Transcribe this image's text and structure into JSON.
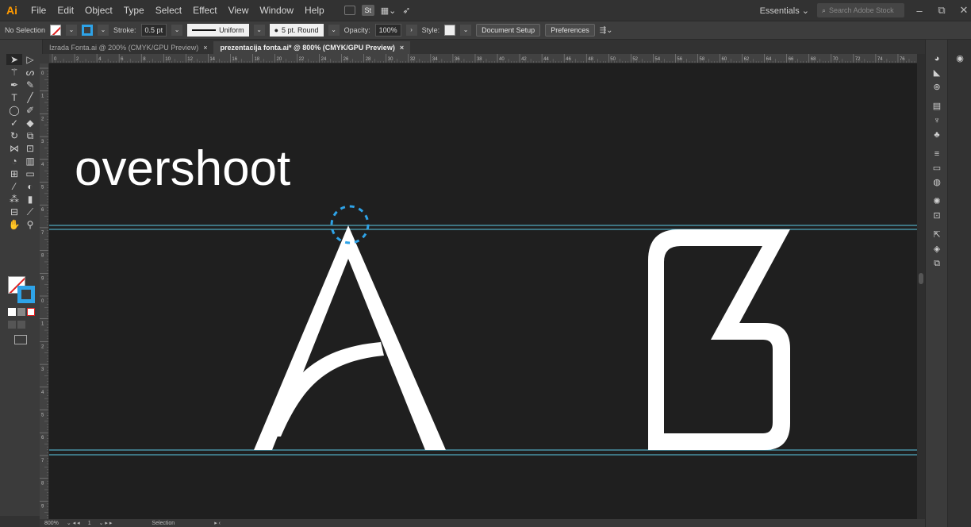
{
  "app": {
    "logo": "Ai"
  },
  "menu": [
    "File",
    "Edit",
    "Object",
    "Type",
    "Select",
    "Effect",
    "View",
    "Window",
    "Help"
  ],
  "menu_icons": {
    "st_label": "St"
  },
  "workspace": {
    "label": "Essentials ⌄",
    "search_placeholder": "Search Adobe Stock"
  },
  "window_controls": {
    "minimize": "–",
    "restore": "⧉",
    "close": "✕"
  },
  "control_bar": {
    "selection": "No Selection",
    "stroke_label": "Stroke:",
    "stroke_value": "0.5 pt",
    "stroke_profile": "Uniform",
    "brush": "5 pt. Round",
    "opacity_label": "Opacity:",
    "opacity_value": "100%",
    "style_label": "Style:",
    "doc_setup": "Document Setup",
    "preferences": "Preferences"
  },
  "tabs": [
    {
      "label": "Izrada Fonta.ai @ 200% (CMYK/GPU Preview)",
      "close": "×"
    },
    {
      "label": "prezentacija fonta.ai* @ 800% (CMYK/GPU Preview)",
      "close": "×"
    }
  ],
  "canvas": {
    "heading": "overshoot",
    "background": "#1f1f1f",
    "guide_color": "#5bc8e6",
    "letters": [
      "A",
      "B"
    ],
    "highlight_color": "#2ea3e8"
  },
  "status": {
    "zoom": "800%",
    "artboard": "1",
    "tool": "Selection"
  },
  "ruler_top_ticks": [
    "0",
    "2",
    "4",
    "6",
    "8",
    "10",
    "12",
    "14",
    "16",
    "18",
    "20",
    "22",
    "24",
    "26",
    "28",
    "30",
    "32",
    "34",
    "36",
    "38",
    "40",
    "42",
    "44",
    "46",
    "48",
    "50",
    "52",
    "54",
    "56",
    "58",
    "60",
    "62",
    "64",
    "66",
    "68",
    "70",
    "72",
    "74",
    "76"
  ],
  "ruler_left_ticks": [
    "0",
    "1",
    "2",
    "3",
    "4",
    "5",
    "6",
    "7",
    "8",
    "9",
    "0",
    "1",
    "2",
    "3",
    "4",
    "5",
    "6",
    "7",
    "8",
    "9"
  ]
}
